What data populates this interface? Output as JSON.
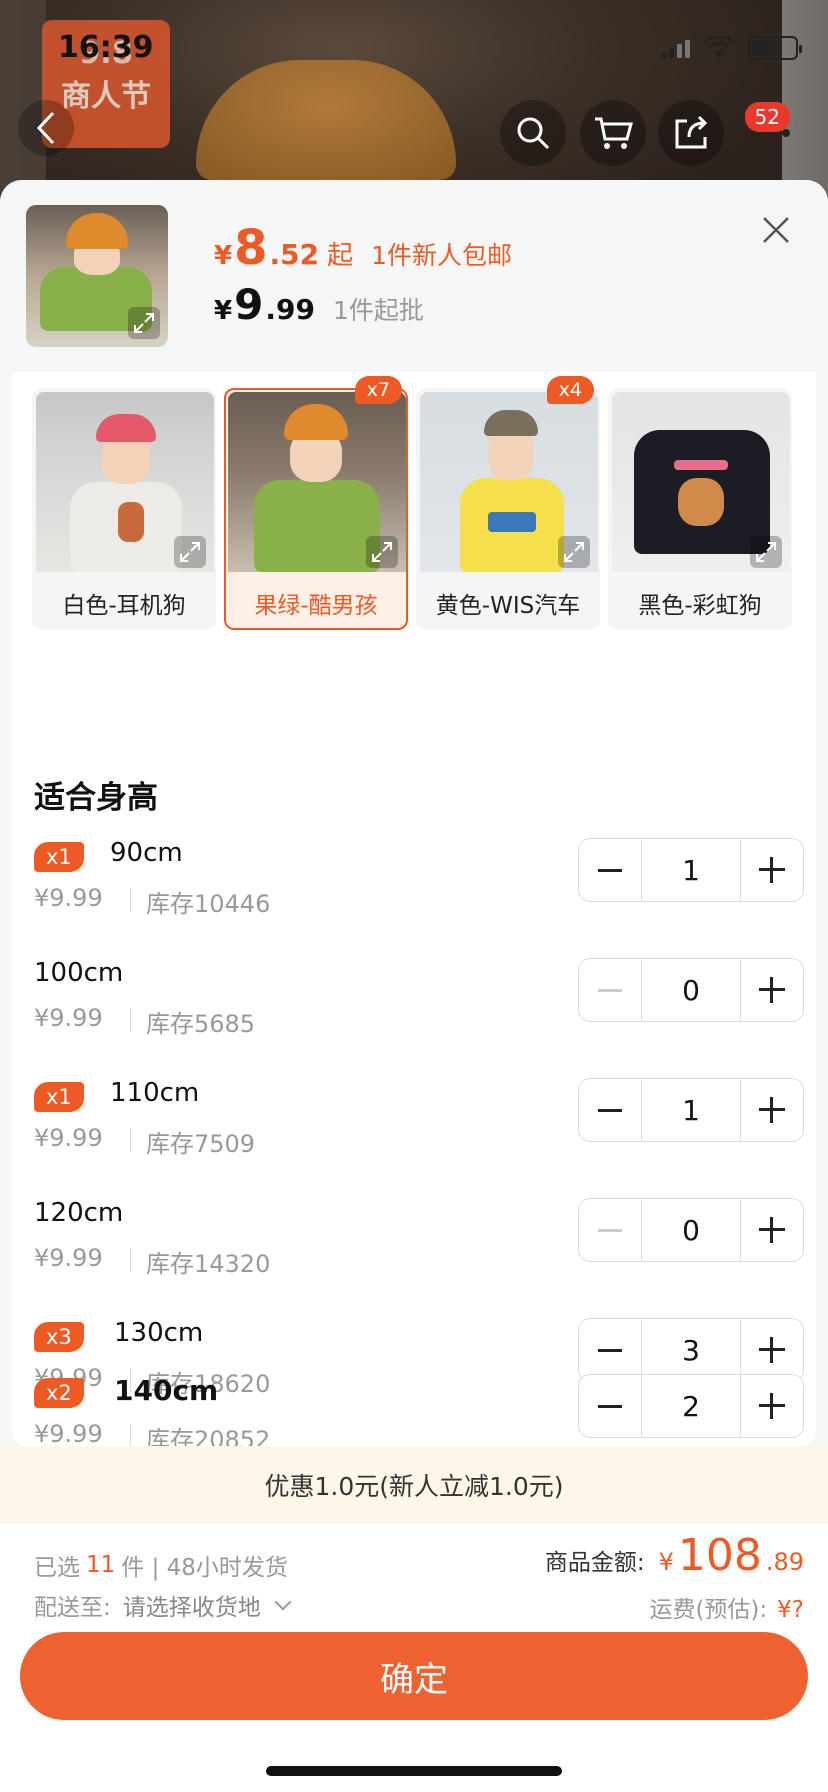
{
  "status_bar": {
    "time": "16:39"
  },
  "festival_banner": {
    "top": "9.8",
    "bottom": "商人节"
  },
  "nav": {
    "cart_badge": "52"
  },
  "header": {
    "price_currency": "¥",
    "price_int": "8",
    "price_dec": ".52",
    "price_suffix": "起",
    "promo": "1件新人包邮",
    "base_currency": "¥",
    "base_int": "9",
    "base_dec": ".99",
    "moq": "1件起批"
  },
  "variants": [
    {
      "label": "白色-耳机狗",
      "count": "",
      "selected": false
    },
    {
      "label": "果绿-酷男孩",
      "count": "x7",
      "selected": true
    },
    {
      "label": "黄色-WIS汽车",
      "count": "x4",
      "selected": false
    },
    {
      "label": "黑色-彩虹狗",
      "count": "",
      "selected": false
    }
  ],
  "section_title": "适合身高",
  "sizes": [
    {
      "tag": "x1",
      "name": "90cm",
      "price": "¥9.99",
      "stock": "库存10446",
      "qty": "1",
      "minus_enabled": true,
      "bold": false
    },
    {
      "tag": "",
      "name": "100cm",
      "price": "¥9.99",
      "stock": "库存5685",
      "qty": "0",
      "minus_enabled": false,
      "bold": false
    },
    {
      "tag": "x1",
      "name": "110cm",
      "price": "¥9.99",
      "stock": "库存7509",
      "qty": "1",
      "minus_enabled": true,
      "bold": false
    },
    {
      "tag": "",
      "name": "120cm",
      "price": "¥9.99",
      "stock": "库存14320",
      "qty": "0",
      "minus_enabled": false,
      "bold": false
    },
    {
      "tag": "x3",
      "name": "130cm",
      "price": "¥9.99",
      "stock": "库存18620",
      "qty": "3",
      "minus_enabled": true,
      "bold": false
    },
    {
      "tag": "x2",
      "name": "140cm",
      "price": "¥9.99",
      "stock": "库存20852",
      "qty": "2",
      "minus_enabled": true,
      "bold": true
    }
  ],
  "discount_text": "优惠1.0元(新人立减1.0元)",
  "footer": {
    "selected_prefix": "已选",
    "selected_count": "11",
    "selected_suffix": "件 | 48小时发货",
    "ship_label": "配送至:",
    "ship_addr": "请选择收货地",
    "amount_label": "商品金额:",
    "amount_currency": "¥",
    "amount_int": "108",
    "amount_dec": ".89",
    "fee_label": "运费(预估):",
    "fee_value": "¥?",
    "confirm": "确定"
  },
  "colors": {
    "accent": "#ee5a24",
    "selected_bg": "#fdf0e9",
    "discount_bg": "#fdf6e9"
  }
}
